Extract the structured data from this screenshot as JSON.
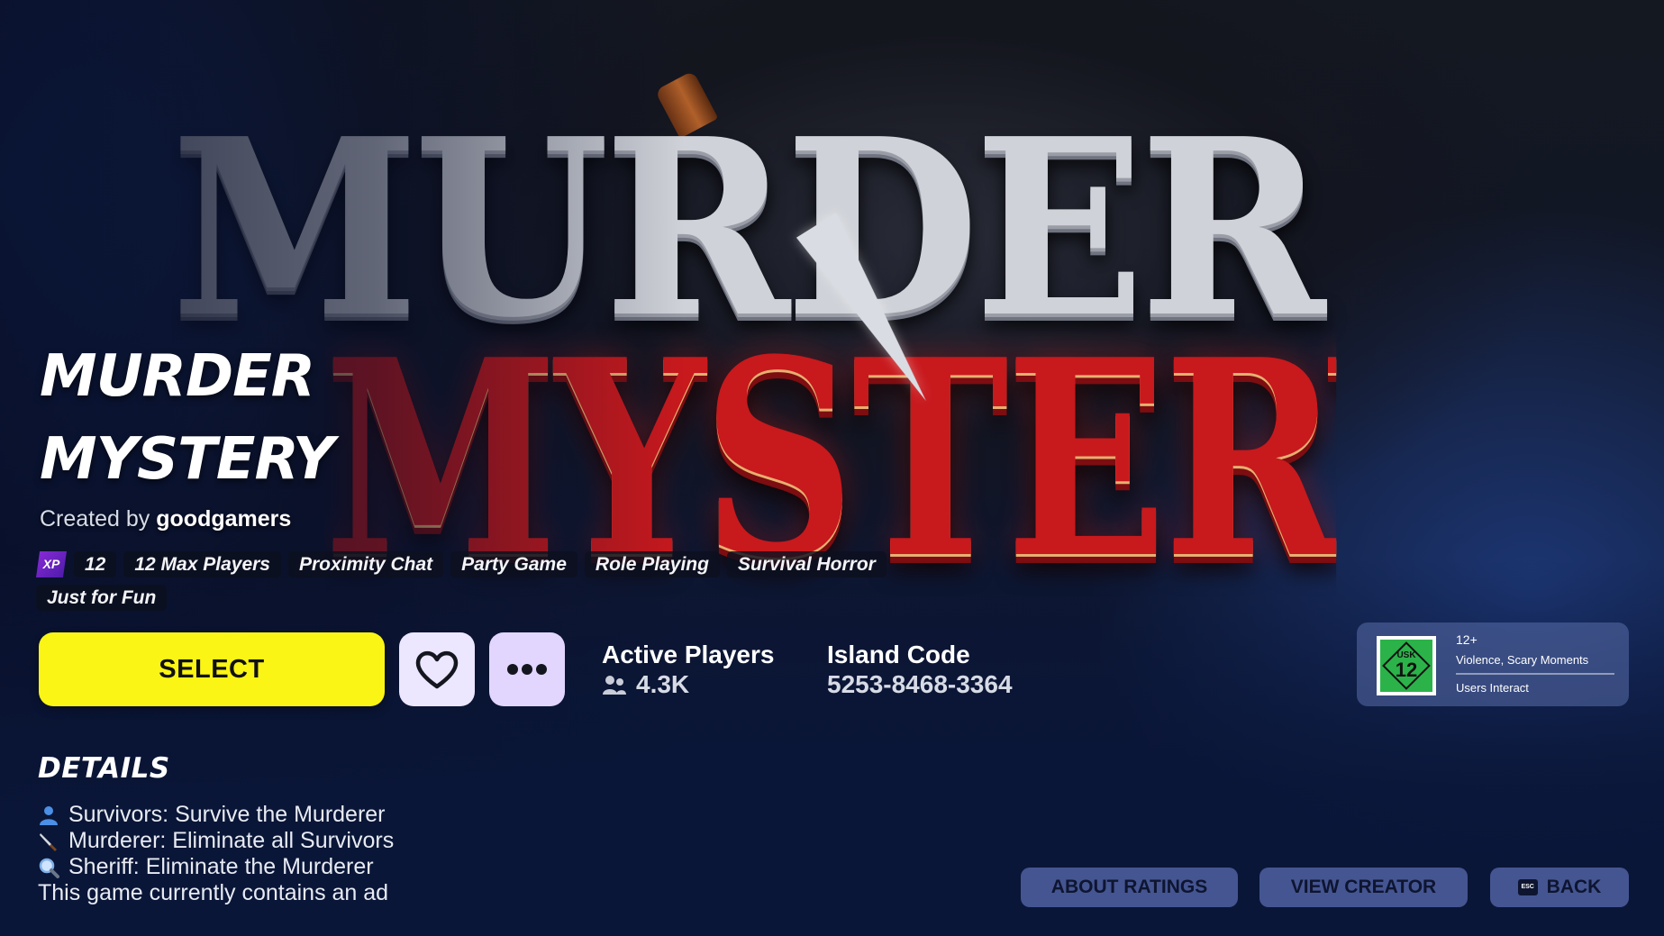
{
  "background_logo": {
    "line1": "MURDER",
    "line2": "MYSTERY"
  },
  "island": {
    "title_line1": "MURDER",
    "title_line2": "MYSTERY",
    "created_by_label": "Created by",
    "creator": "goodgamers"
  },
  "tags": {
    "xp_label": "XP",
    "items": [
      "12",
      "12 Max Players",
      "Proximity Chat",
      "Party Game",
      "Role Playing",
      "Survival Horror",
      "Just for Fun"
    ]
  },
  "actions": {
    "select_label": "SELECT",
    "favorite_icon": "heart-icon",
    "more_icon": "more-dots-icon"
  },
  "stats": {
    "active_players_label": "Active Players",
    "active_players_value": "4.3K",
    "island_code_label": "Island Code",
    "island_code_value": "5253-8468-3364"
  },
  "rating": {
    "badge_top": "USK",
    "badge_number": "12",
    "age": "12+",
    "descriptors": "Violence,  Scary Moments",
    "interactive": "Users Interact",
    "badge_color": "#2bb34a"
  },
  "details": {
    "heading": "DETAILS",
    "lines": [
      {
        "icon": "person-icon",
        "text": "Survivors: Survive the Murderer"
      },
      {
        "icon": "knife-icon",
        "text": "Murderer: Eliminate all Survivors"
      },
      {
        "icon": "magnifier-icon",
        "text": "Sheriff: Eliminate the Murderer"
      }
    ],
    "ad_notice": "This game currently contains an ad"
  },
  "footer": {
    "about_ratings": "ABOUT RATINGS",
    "view_creator": "VIEW CREATOR",
    "back": "BACK",
    "esc_key": "ESC"
  },
  "colors": {
    "select_button": "#faf514",
    "title_red": "#c8191d",
    "title_silver": "#cfd2d8"
  }
}
